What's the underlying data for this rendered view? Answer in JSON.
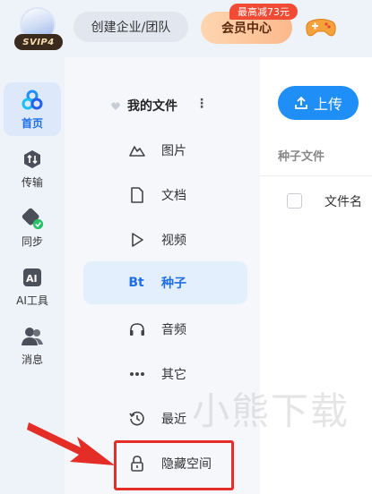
{
  "topbar": {
    "svip_badge": "SVIP4",
    "create_team_label": "创建企业/团队",
    "member_center_label": "会员中心",
    "promo_badge": "最高减73元"
  },
  "leftnav": {
    "items": [
      {
        "label": "首页",
        "icon": "home-icon",
        "active": true
      },
      {
        "label": "传输",
        "icon": "transfer-icon",
        "active": false
      },
      {
        "label": "同步",
        "icon": "sync-icon",
        "active": false
      },
      {
        "label": "AI工具",
        "icon": "ai-tools-icon",
        "active": false
      },
      {
        "label": "消息",
        "icon": "messages-icon",
        "active": false
      }
    ]
  },
  "filenav": {
    "section_label": "我的文件",
    "categories": [
      {
        "label": "图片",
        "icon": "picture-icon"
      },
      {
        "label": "文档",
        "icon": "document-icon"
      },
      {
        "label": "视频",
        "icon": "video-icon"
      },
      {
        "label": "种子",
        "icon": "torrent-icon",
        "glyph": "Bt",
        "active": true
      },
      {
        "label": "音频",
        "icon": "audio-icon"
      },
      {
        "label": "其它",
        "icon": "other-icon"
      },
      {
        "label": "最近",
        "icon": "recent-icon"
      },
      {
        "label": "隐藏空间",
        "icon": "lock-icon"
      }
    ]
  },
  "main": {
    "upload_label": "上传",
    "title": "种子文件",
    "column_filename": "文件名"
  },
  "watermark": "小熊下载",
  "colors": {
    "accent": "#1f8ff7",
    "active_text": "#1f6fe8",
    "highlight": "#e52d27",
    "promo": "#f24b35"
  }
}
